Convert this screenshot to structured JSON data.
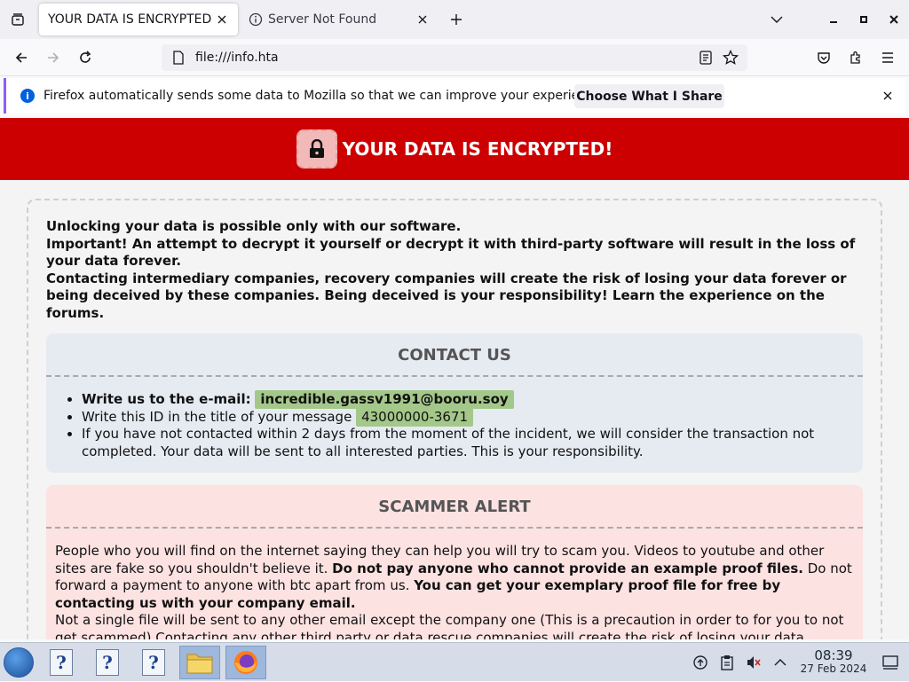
{
  "tabs": [
    {
      "title": "YOUR DATA IS ENCRYPTED!",
      "active": true
    },
    {
      "title": "Server Not Found",
      "active": false
    }
  ],
  "address": {
    "url": "file:///info.hta"
  },
  "notification": {
    "message": "Firefox automatically sends some data to Mozilla so that we can improve your experience.",
    "button": "Choose What I Share"
  },
  "banner": {
    "title": "YOUR DATA IS ENCRYPTED!"
  },
  "intro": {
    "line1": "Unlocking your data is possible only with our software.",
    "line2": "Important! An attempt to decrypt it yourself or decrypt it with third-party software will result in the loss of your data forever.",
    "line3": "Contacting intermediary companies, recovery companies will create the risk of losing your data forever or being deceived by these companies. Being deceived is your responsibility! Learn the experience on the forums."
  },
  "contact": {
    "heading": "CONTACT US",
    "email_label": "Write us to the e-mail:",
    "email": "incredible.gassv1991@booru.soy",
    "id_label": "Write this ID in the title of your message",
    "id": "43000000-3671",
    "warning": "If you have not contacted within 2 days from the moment of the incident, we will consider the transaction not completed. Your data will be sent to all interested parties. This is your responsibility."
  },
  "scam": {
    "heading": "SCAMMER ALERT",
    "p1_a": "People who you will find on the internet saying they can help you will try to scam you. Videos to youtube and other sites are fake so you shouldn't believe it.",
    "p1_b": "Do not pay anyone who cannot provide an example proof files.",
    "p1_c": "Do not forward a payment to anyone with btc apart from us.",
    "p1_d": "You can get your exemplary proof file for free by contacting us with your company email.",
    "p2": "Not a single file will be sent to any other email except the company one (This is a precaution in order to for you to not get scammed) Contacting any other third party or data rescue companies will create the risk of losing your data forever"
  },
  "taskbar": {
    "time": "08:39",
    "date": "27 Feb 2024"
  },
  "colors": {
    "banner_red": "#cc0000",
    "contact_bg": "#e6ebf2",
    "scam_bg": "#fde2e2",
    "highlight_green": "#a4c88a"
  }
}
